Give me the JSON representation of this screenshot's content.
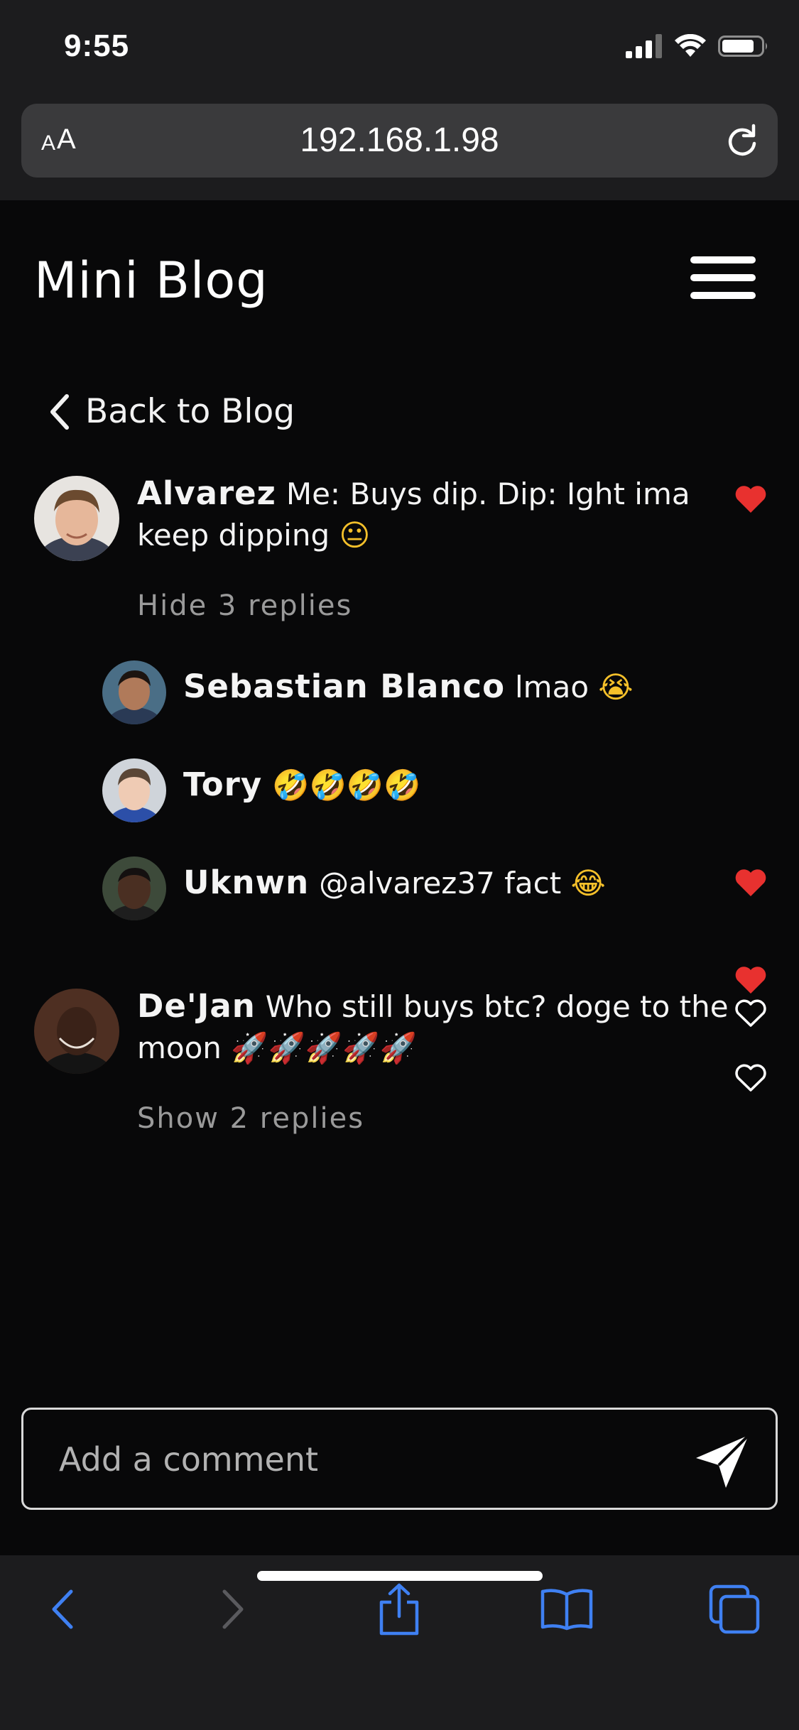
{
  "status_bar": {
    "time": "9:55"
  },
  "browser": {
    "text_size_label_small": "A",
    "text_size_label_large": "A",
    "url": "192.168.1.98"
  },
  "header": {
    "title": "Mini Blog"
  },
  "back_link": {
    "label": "Back to Blog"
  },
  "comments": [
    {
      "author": "Alvarez",
      "text_line1": "Me: Buys dip. Dip: Ight ima",
      "text_line2": "keep dipping",
      "emoji": "😐",
      "liked": true,
      "replies_toggle": "Hide 3 replies",
      "replies": [
        {
          "author": "Sebastian Blanco",
          "text": "lmao",
          "emoji": "😭",
          "liked": true
        },
        {
          "author": "Tory",
          "text": "",
          "emoji": "🤣🤣🤣🤣",
          "liked": true
        },
        {
          "author": "Uknwn",
          "text": "@alvarez37 fact",
          "emoji": "😂",
          "liked": false
        }
      ]
    },
    {
      "author": "De'Jan",
      "text_line1": "Who still buys btc? doge to the",
      "text_line2": "moon",
      "emoji": "🚀🚀🚀🚀🚀",
      "liked": false,
      "replies_toggle": "Show 2 replies"
    }
  ],
  "comment_input": {
    "placeholder": "Add a comment",
    "value": ""
  },
  "colors": {
    "background": "#080809",
    "chrome": "#1c1c1e",
    "heart_liked": "#e8312f",
    "toolbar_accent": "#3f80f2",
    "muted_text": "#9a9a9a"
  },
  "icons": {
    "status": [
      "cellular-signal-icon",
      "wifi-icon",
      "battery-icon"
    ],
    "toolbar": [
      "back-arrow-icon",
      "forward-arrow-icon",
      "share-icon",
      "bookmarks-icon",
      "tabs-icon"
    ]
  }
}
